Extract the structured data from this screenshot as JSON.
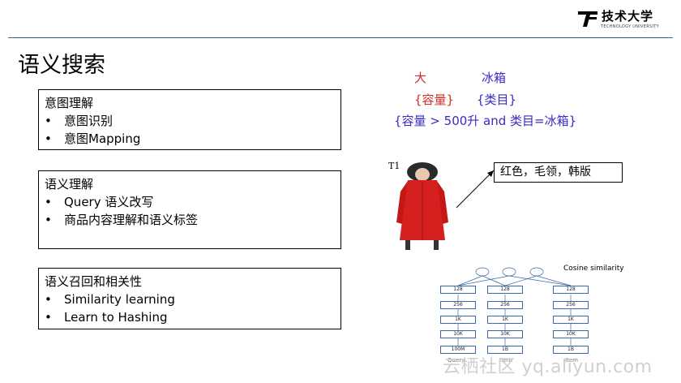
{
  "header": {
    "logo_name": "技术大学",
    "logo_subtitle": "TECHNOLOGY UNIVERSITY",
    "rule_color": "#2f5f8c"
  },
  "title": "语义搜索",
  "boxes": [
    {
      "heading": "意图理解",
      "items": [
        "意图识别",
        "意图Mapping"
      ]
    },
    {
      "heading": "语义理解",
      "items": [
        "Query  语义改写",
        "商品内容理解和语义标签"
      ]
    },
    {
      "heading": "语义召回和相关性",
      "items": [
        "Similarity learning",
        "Learn to Hashing"
      ]
    }
  ],
  "query": {
    "word1": "大",
    "word2": "冰箱",
    "tag1": "{容量}",
    "tag2": "{类目}",
    "structured": "{容量 > 500升  and    类目=冰箱}",
    "colors": {
      "attribute": "#d42b2b",
      "category": "#3a2bbf"
    }
  },
  "product": {
    "tag": "T1",
    "callout": "红色，毛领，韩版"
  },
  "network": {
    "title": "Cosine similarity",
    "columns": [
      {
        "name": "Query",
        "layers": [
          "128",
          "256",
          "1K",
          "10K",
          "100M"
        ]
      },
      {
        "name": "Item",
        "layers": [
          "128",
          "256",
          "1K",
          "10K",
          "1B"
        ]
      },
      {
        "name": "Item",
        "layers": [
          "128",
          "256",
          "1K",
          "10K",
          "1B"
        ]
      }
    ]
  },
  "watermark": "云栖社区 yq.aliyun.com"
}
